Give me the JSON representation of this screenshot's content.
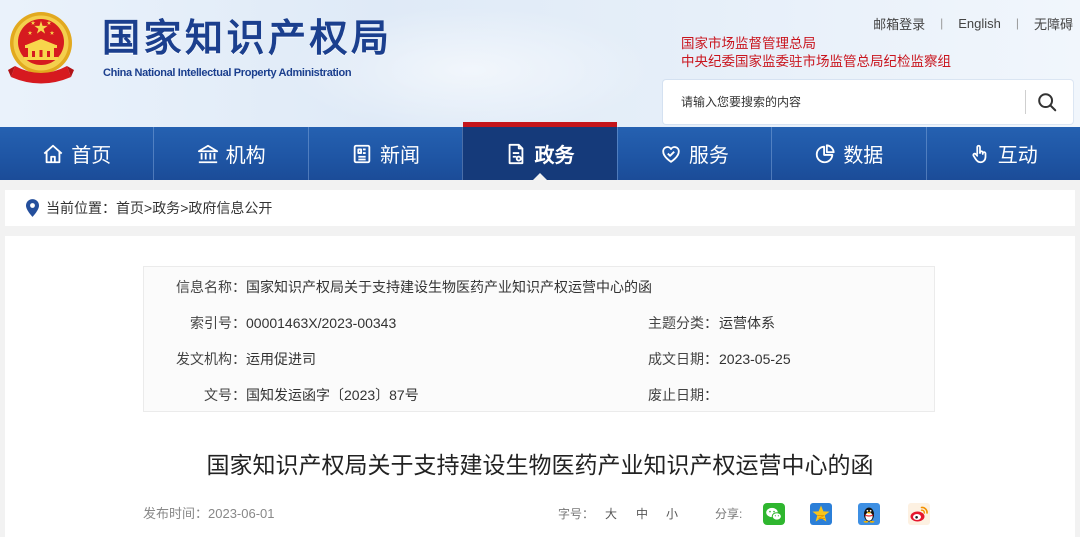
{
  "site": {
    "title": "国家知识产权局",
    "subtitle": "China National Intellectual Property Administration",
    "emblem_icon": "national-emblem-icon"
  },
  "top_links": {
    "email_login": "邮箱登录",
    "english": "English",
    "accessibility": "无障碍",
    "separator": "|"
  },
  "affiliations": [
    "国家市场监督管理总局",
    "中央纪委国家监委驻市场监管总局纪检监察组"
  ],
  "search": {
    "placeholder": "请输入您要搜索的内容",
    "icon": "search-icon"
  },
  "nav": {
    "items": [
      {
        "label": "首页",
        "icon": "home-icon",
        "active": false
      },
      {
        "label": "机构",
        "icon": "institution-icon",
        "active": false
      },
      {
        "label": "新闻",
        "icon": "news-icon",
        "active": false
      },
      {
        "label": "政务",
        "icon": "affairs-document-icon",
        "active": true
      },
      {
        "label": "服务",
        "icon": "service-heart-icon",
        "active": false
      },
      {
        "label": "数据",
        "icon": "data-pie-icon",
        "active": false
      },
      {
        "label": "互动",
        "icon": "interaction-hand-icon",
        "active": false
      }
    ]
  },
  "breadcrumb": {
    "icon": "location-pin-icon",
    "label": "当前位置：",
    "items": [
      "首页",
      "政务",
      "政府信息公开"
    ],
    "separator": ">"
  },
  "info": {
    "name_label": "信息名称：",
    "name_value": "国家知识产权局关于支持建设生物医药产业知识产权运营中心的函",
    "rows": [
      {
        "left_label": "索引号：",
        "left_value": "00001463X/2023-00343",
        "right_label": "主题分类：",
        "right_value": "运营体系"
      },
      {
        "left_label": "发文机构：",
        "left_value": "运用促进司",
        "right_label": "成文日期：",
        "right_value": "2023-05-25"
      },
      {
        "left_label": "文号：",
        "left_value": "国知发运函字〔2023〕87号",
        "right_label": "废止日期：",
        "right_value": ""
      }
    ]
  },
  "document": {
    "title": "国家知识产权局关于支持建设生物医药产业知识产权运营中心的函"
  },
  "meta": {
    "publish_label": "发布时间：",
    "publish_date": "2023-06-01",
    "font_size_label": "字号：",
    "font_sizes": [
      "大",
      "中",
      "小"
    ],
    "share_label": "分享:",
    "share_icons": [
      "wechat-icon",
      "qzone-icon",
      "qq-icon",
      "weibo-icon"
    ]
  },
  "colors": {
    "nav_bg": "#1f56a5",
    "nav_active": "#153a7a",
    "title": "#1b3f8e",
    "affiliation": "#c9151e",
    "accent_red": "#c4161c"
  }
}
